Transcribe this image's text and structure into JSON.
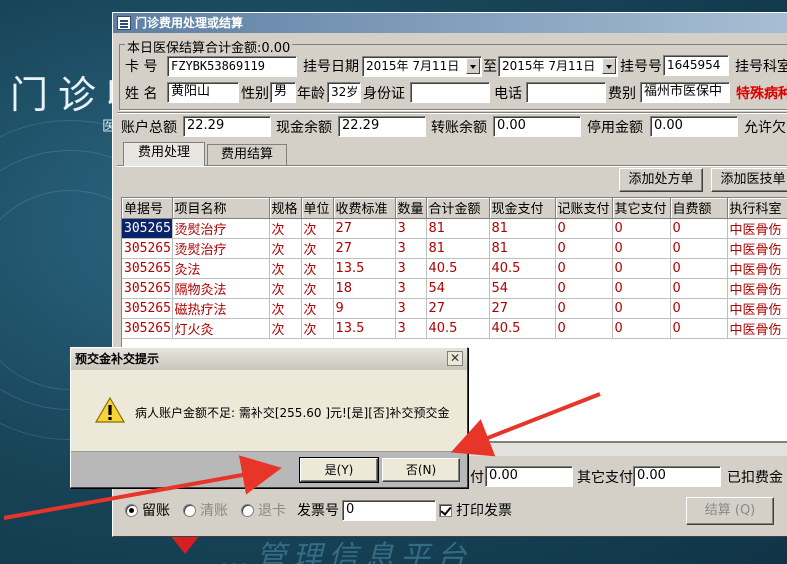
{
  "background": {
    "title": "门诊收",
    "subtitle": "医",
    "footer_watermark": "…管理信息平台"
  },
  "window": {
    "title": "门诊费用处理或结算",
    "daily_total_label": "本日医保结算合计金额:0.00",
    "card_label": "卡  号",
    "card_value": "FZYBK53869119",
    "reg_date_label": "挂号日期",
    "reg_date_from": "2015年  7月11日",
    "to_label": "至",
    "reg_date_to": "2015年  7月11日",
    "reg_no_label": "挂号号",
    "reg_no_value": "1645954",
    "reg_dept_label": "挂号科室",
    "name_label": "姓  名",
    "name_value": "黄阳山",
    "gender_label": "性别",
    "gender_value": "男",
    "age_label": "年龄",
    "age_value": "32岁",
    "id_label": "身份证",
    "id_value": "",
    "phone_label": "电话",
    "phone_value": "",
    "fee_type_label": "费别",
    "fee_type_value": "福州市医保中",
    "special_label": "特殊病种",
    "account_total_label": "账户总额",
    "account_total_value": "22.29",
    "cash_balance_label": "现金余额",
    "cash_balance_value": "22.29",
    "transfer_balance_label": "转账余额",
    "transfer_balance_value": "0.00",
    "stop_amount_label": "停用金额",
    "stop_amount_value": "0.00",
    "allow_owe_label": "允许欠",
    "tabs": [
      "费用处理",
      "费用结算"
    ],
    "add_prescription_label": "添加处方单",
    "add_tech_label": "添加医技单",
    "columns": [
      "单据号",
      "项目名称",
      "规格",
      "单位",
      "收费标准",
      "数量",
      "合计金额",
      "现金支付",
      "记账支付",
      "其它支付",
      "自费额",
      "执行科室"
    ],
    "rows": [
      [
        "305265",
        "烫熨治疗",
        "次",
        "次",
        "27",
        "3",
        "81",
        "81",
        "0",
        "0",
        "0",
        "中医骨伤"
      ],
      [
        "305265",
        "烫熨治疗",
        "次",
        "次",
        "27",
        "3",
        "81",
        "81",
        "0",
        "0",
        "0",
        "中医骨伤"
      ],
      [
        "305265",
        "灸法",
        "次",
        "次",
        "13.5",
        "3",
        "40.5",
        "40.5",
        "0",
        "0",
        "0",
        "中医骨伤"
      ],
      [
        "305265",
        "隔物灸法",
        "次",
        "次",
        "18",
        "3",
        "54",
        "54",
        "0",
        "0",
        "0",
        "中医骨伤"
      ],
      [
        "305265",
        "磁热疗法",
        "次",
        "次",
        "9",
        "3",
        "27",
        "27",
        "0",
        "0",
        "0",
        "中医骨伤"
      ],
      [
        "305265",
        "灯火灸",
        "次",
        "次",
        "13.5",
        "3",
        "40.5",
        "40.5",
        "0",
        "0",
        "0",
        "中医骨伤"
      ]
    ],
    "pay_partial_label": "付",
    "pay_partial_value": "0.00",
    "other_pay_label": "其它支付",
    "other_pay_value": "0.00",
    "deducted_label": "已扣费金",
    "radio_keep": "留账",
    "radio_clear": "清账",
    "radio_refund": "退卡",
    "invoice_label": "发票号",
    "invoice_value": "0",
    "print_invoice_label": "打印发票",
    "settle_label": "结算 (Q)"
  },
  "dialog": {
    "title": "预交金补交提示",
    "message": "病人账户金额不足: 需补交[255.60 ]元![是][否]补交预交金",
    "yes_label": "是(Y)",
    "no_label": "否(N)",
    "close_glyph": "✕"
  },
  "colors": {
    "title_bar": "#5d7fa3",
    "row_text": "#b00000",
    "selection": "#0a246a",
    "special_label": "#e00000",
    "annotation_arrow": "#e8352a"
  }
}
